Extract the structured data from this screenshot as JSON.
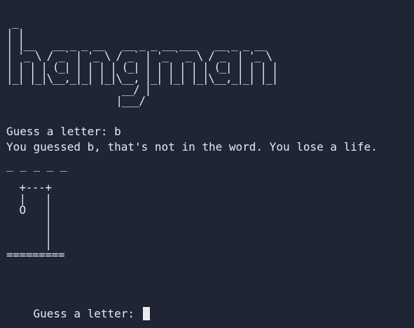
{
  "terminal": {
    "banner_art": " _\n| |\n| |__   __ _ _ __   __ _ _ __ ___   __ _ _ __\n| '_ \\ / _` | '_ \\ / _` | '_ ` _ \\ / _` | '_ \\\n| | | | (_| | | | | (_| | | | | | | (_| | | | |\n|_| |_|\\__,_|_| |_|\\__, |_| |_| |_|\\__,_|_| |_|\n                    __/ |\n                   |___/",
    "prompt_1": "Guess a letter: b",
    "feedback": "You guessed b, that's not in the word. You lose a life.",
    "word_progress": "_ _ _ _ _",
    "gallows_art": "  +---+\n  |   |\n  O   |\n      |\n      |\n      |\n=========",
    "prompt_2": "Guess a letter: "
  }
}
